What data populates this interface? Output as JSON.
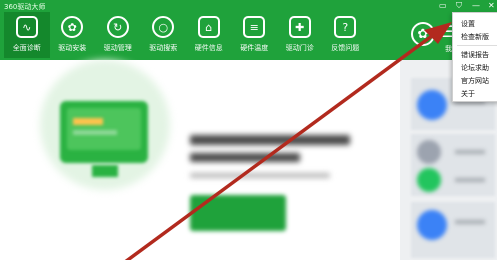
{
  "app": {
    "title": "360驱动大师"
  },
  "window_controls": {
    "skin": "▭",
    "shield": "⛉",
    "minimize": "—",
    "close": "✕"
  },
  "nav": [
    {
      "label": "全面诊断",
      "icon": "monitor-diagnose-icon",
      "glyph": "∿",
      "active": true
    },
    {
      "label": "驱动安装",
      "icon": "gear-install-icon",
      "glyph": "✿"
    },
    {
      "label": "驱动管理",
      "icon": "refresh-manage-icon",
      "glyph": "↻"
    },
    {
      "label": "驱动搜索",
      "icon": "search-icon",
      "glyph": "○"
    },
    {
      "label": "硬件信息",
      "icon": "hardware-info-icon",
      "glyph": "⌂"
    },
    {
      "label": "硬件温度",
      "icon": "temperature-icon",
      "glyph": "≡"
    },
    {
      "label": "驱动门诊",
      "icon": "clinic-icon",
      "glyph": "✚"
    },
    {
      "label": "反馈问题",
      "icon": "question-icon",
      "glyph": "?"
    }
  ],
  "header_right": {
    "gear_icon": "settings-gear-icon",
    "menu_icon": "menu-icon",
    "side_label": "我"
  },
  "dropdown_menu": [
    {
      "label": "设置"
    },
    {
      "label": "检查新版"
    },
    {
      "label": "错误报告"
    },
    {
      "label": "论坛求助"
    },
    {
      "label": "官方网站"
    },
    {
      "label": "关于"
    }
  ],
  "colors": {
    "brand_green": "#1fa23b",
    "active_tab": "#14882c",
    "arrow_red": "#b22a1e"
  }
}
